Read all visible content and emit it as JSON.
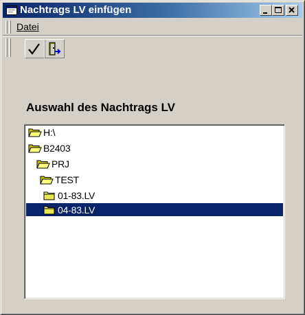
{
  "window": {
    "title": "Nachtrags LV einfügen"
  },
  "titlebar_buttons": {
    "minimize_icon": "minimize-icon",
    "maximize_icon": "maximize-icon",
    "close_icon": "close-icon"
  },
  "menu": {
    "items": [
      {
        "label": "Datei"
      }
    ]
  },
  "toolbar": {
    "check_icon": "check-icon",
    "exit_icon": "exit-door-icon"
  },
  "main": {
    "heading": "Auswahl des Nachtrags LV"
  },
  "tree": {
    "items": [
      {
        "label": "H:\\",
        "icon": "open-folder-icon",
        "level": 0
      },
      {
        "label": "B2403",
        "icon": "open-folder-icon",
        "level": 1
      },
      {
        "label": "PRJ",
        "icon": "open-folder-icon",
        "level": 2
      },
      {
        "label": "TEST",
        "icon": "open-folder-icon",
        "level": 3
      },
      {
        "label": "01-83.LV",
        "icon": "closed-folder-icon",
        "level": 4
      },
      {
        "label": "04-83.LV",
        "icon": "closed-folder-icon",
        "level": 4,
        "selected": true
      }
    ],
    "selection_color": "#0a246a"
  },
  "colors": {
    "titlebar_start": "#0a246a",
    "titlebar_end": "#a6caf0",
    "face": "#d4d0c8"
  }
}
